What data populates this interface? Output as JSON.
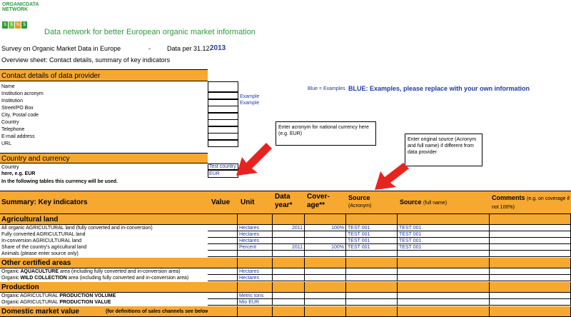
{
  "logo": {
    "line1": "ORGANICDATA",
    "line2": "NETWORK",
    "squares": [
      "$",
      "$",
      "%",
      "$"
    ]
  },
  "tagline": "Data network for better European organic market information",
  "survey": {
    "title": "Survey on Organic Market Data in Europe",
    "dash": "-",
    "data_per": "Data per 31.12.",
    "year": "2013"
  },
  "overview": "Overview sheet: Contact details, summary of key indicators",
  "contact": {
    "header": "Contact details of data provider",
    "fields": [
      "Name",
      "Institution acronym",
      "Institution",
      "Street/PO Box",
      "City, Postal code",
      "Country",
      "Telephone",
      "E-mail address",
      "URL"
    ],
    "example1": "Example",
    "example2": "Example"
  },
  "legend": {
    "small": "Blue = Examples",
    "big": "BLUE: Examples, please replace with your own information"
  },
  "notes": {
    "currency": "Enter acronym for national currency here (e.g. EUR)",
    "source": "Enter original source (Acronym and full name)  if different from data provider"
  },
  "currency": {
    "header": "Country and currency",
    "country_label": "Country",
    "country_value": "Test country",
    "here_label": "here, e.g. EUR",
    "here_value": "EUR",
    "note": "In the following tables this currency will be used."
  },
  "summary": {
    "header": "Summary: Key indicators",
    "columns": {
      "value": "Value",
      "unit": "Unit",
      "year": "Data year*",
      "cover1": "Cover-",
      "cover2": "age**",
      "source": "Source",
      "source_sub": "(Acronym)",
      "source_full": "Source",
      "source_full_sub": "(full name)",
      "comments": "Comments",
      "comments_sub": "(e.g. on coverage if not 100%)"
    }
  },
  "sections": {
    "agri": "Agricultural land",
    "other": "Other certified areas",
    "production": "Production",
    "domestic": "Domestic market value",
    "domestic_sub": "(for definitions of sales channels see below)"
  },
  "agri_rows": [
    {
      "label": "All organic AGRICULTURAL land (fully converted and in-conversion)",
      "unit": "Hectares",
      "year": "2011",
      "cov": "100%",
      "src": "TEST 001",
      "src_full": "TEST 001"
    },
    {
      "label": "Fully converted AGRICULTURAL land",
      "unit": "Hectares",
      "year": "",
      "cov": "",
      "src": "TEST 001",
      "src_full": "TEST 001"
    },
    {
      "label": "In-conversion AGRICULTURAL land",
      "unit": "Hectares",
      "year": "",
      "cov": "",
      "src": "TEST 001",
      "src_full": "TEST 001"
    },
    {
      "label": "Share of the country's agricultural land",
      "unit": "Percent",
      "year": "2011",
      "cov": "100%",
      "src": "TEST 001",
      "src_full": "TEST 001"
    },
    {
      "label": "Animals (please enter source only)",
      "unit": "",
      "year": "",
      "cov": "",
      "src": "",
      "src_full": ""
    }
  ],
  "other_rows": [
    {
      "pre": "Organic ",
      "bold": "AQUACULTURE",
      "post": " area     (including fully converted and in-conversion area)",
      "unit": "Hectares"
    },
    {
      "pre": "Organic ",
      "bold": "WILD COLLECTION",
      "post": " area  (including fully converted and in-conversion area)",
      "unit": "Hectares"
    }
  ],
  "production_rows": [
    {
      "pre": "Organic AGRICULTURAL ",
      "bold": "PRODUCTION VOLUME",
      "unit": "Metric tons"
    },
    {
      "pre": "Organic AGRICULTURAL ",
      "bold": "PRODUCTION VALUE",
      "unit": "Mio EUR"
    }
  ],
  "colors": {
    "orange": "#f7a831",
    "blue": "#1f3aa8",
    "arrow": "#e8231f",
    "green": "#2e9a3e"
  }
}
